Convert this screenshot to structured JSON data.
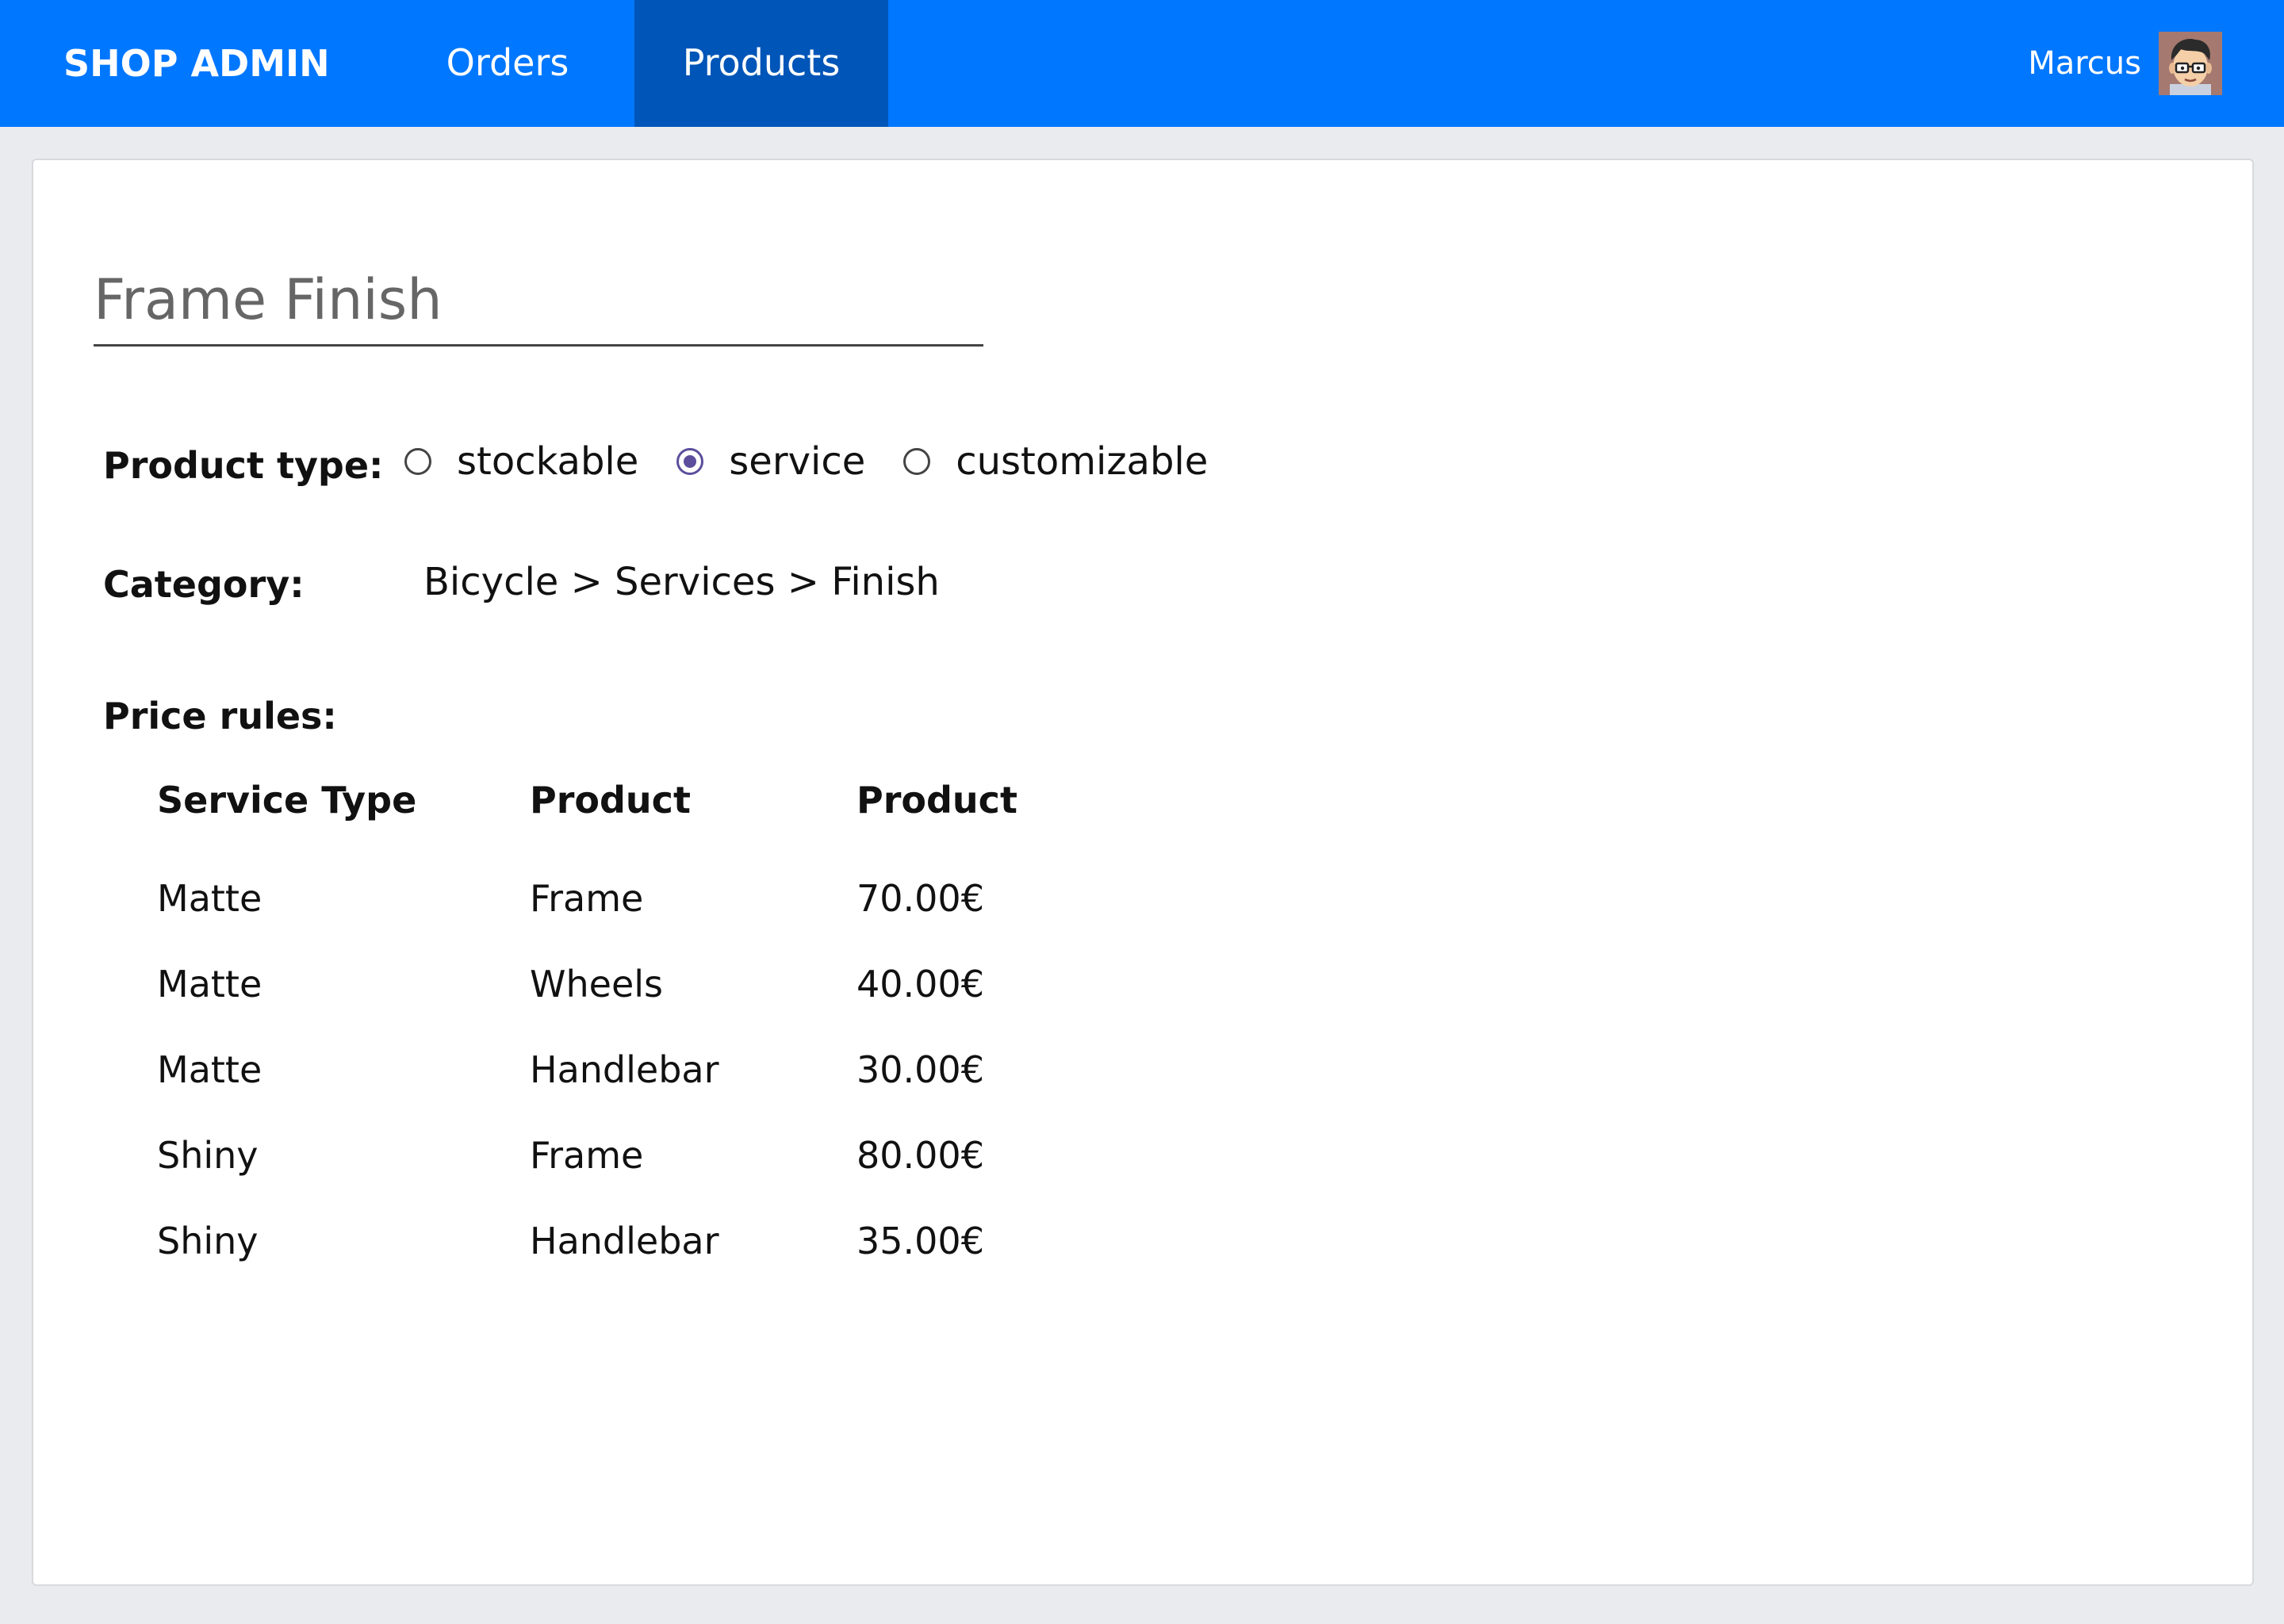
{
  "header": {
    "brand": "SHOP ADMIN",
    "nav": {
      "orders": "Orders",
      "products": "Products"
    },
    "user_name": "Marcus"
  },
  "colors": {
    "topbar": "#0077ff",
    "active_tab": "#0055b8",
    "radio_checked": "#5c4e9c"
  },
  "product": {
    "name": "Frame Finish",
    "type_label": "Product type:",
    "type_options": [
      "stockable",
      "service",
      "customizable"
    ],
    "selected_type": "service",
    "category_label": "Category:",
    "category_path": "Bicycle > Services > Finish"
  },
  "price_rules": {
    "label": "Price rules:",
    "columns": [
      "Service Type",
      "Product",
      "Product"
    ],
    "rows": [
      [
        "Matte",
        "Frame",
        "70.00€"
      ],
      [
        "Matte",
        "Wheels",
        "40.00€"
      ],
      [
        "Matte",
        "Handlebar",
        "30.00€"
      ],
      [
        "Shiny",
        "Frame",
        "80.00€"
      ],
      [
        "Shiny",
        "Handlebar",
        "35.00€"
      ]
    ]
  },
  "icons": {
    "avatar": "user-avatar-cartoon-face"
  }
}
